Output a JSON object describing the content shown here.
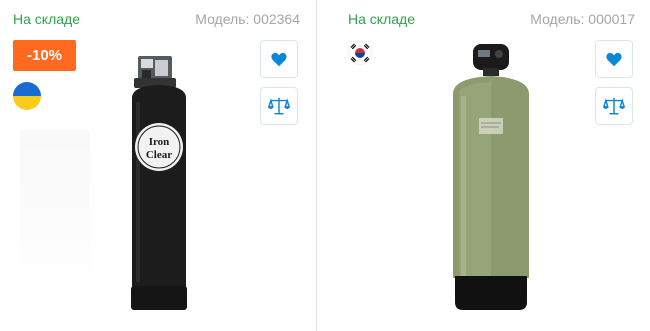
{
  "products": [
    {
      "stock_status": "На складе",
      "model": "Модель: 002364",
      "discount_badge": "-10%",
      "country_flag": "ukraine-flag-icon",
      "label_text": "Iron Clear",
      "colors": {
        "stock": "#2fa34a",
        "badge": "#ff6a1e",
        "tank": "#1c1c1c",
        "accent": "#0a88d6"
      }
    },
    {
      "stock_status": "На складе",
      "model": "Модель: 000017",
      "country_flag": "south-korea-flag-icon",
      "colors": {
        "stock": "#2fa34a",
        "tank": "#8c9a6e",
        "base": "#111111",
        "accent": "#0a88d6"
      }
    }
  ],
  "actions": {
    "favorite_icon": "heart-icon",
    "compare_icon": "scales-icon"
  }
}
